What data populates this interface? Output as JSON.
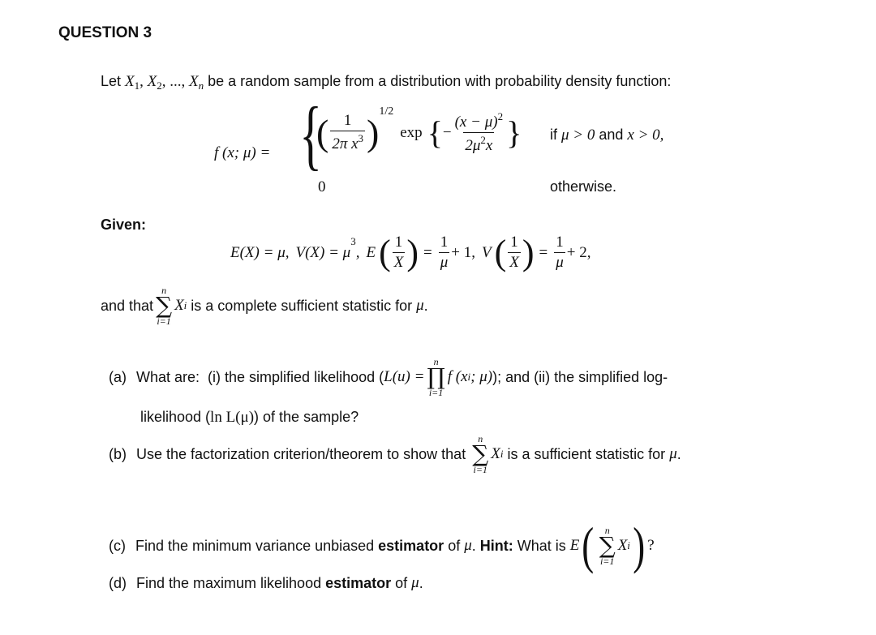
{
  "question_title": "QUESTION 3",
  "intro": {
    "prefix": "Let ",
    "x1": "X",
    "x1_sub": "1",
    "x2": "X",
    "x2_sub": "2",
    "dots": ", ..., ",
    "xn": "X",
    "xn_sub": "n",
    "suffix": " be a random sample from a distribution with probability density function:"
  },
  "pdf": {
    "lhs": "f (x; μ) =",
    "case1": {
      "frac_num": "1",
      "frac_den": "2π x",
      "frac_den_sup": "3",
      "power": "1/2",
      "exp_label": "exp",
      "minus": "−",
      "exp_num": "(x − μ)",
      "exp_num_sup": "2",
      "exp_den": "2μ",
      "exp_den_sup": "2",
      "exp_den_tail": "x",
      "condition_if": "if ",
      "condition_mu": "μ > 0",
      "condition_and": " and ",
      "condition_x": "x > 0,"
    },
    "case2": {
      "value": "0",
      "condition": "otherwise."
    }
  },
  "given": {
    "label": "Given:",
    "ex": "E(X) = μ,",
    "vx": "V(X) = μ",
    "vx_sup": "3",
    "vx_comma": ",",
    "e_inv": "E",
    "inv_num": "1",
    "inv_den": "X",
    "eq": "=",
    "mu_num": "1",
    "mu_den": "μ",
    "plus1": "+ 1,",
    "v_inv": "V",
    "plus2": "+ 2,"
  },
  "sufficient": {
    "prefix": "and that ",
    "sum_top": "n",
    "sum_bottom": "i=1",
    "sum_symbol": "∑",
    "term": "X",
    "term_sub": "i",
    "suffix": " is a complete sufficient statistic for ",
    "mu": "μ",
    "end": "."
  },
  "parts": {
    "a": {
      "label": "(a)",
      "text1": "What are:  (i) the simplified likelihood (",
      "L": "L(u) =",
      "prod_top": "n",
      "prod_bottom": "i=1",
      "prod_symbol": "∏",
      "f_term": "f (x",
      "f_sub": "i",
      "f_tail": "; μ)",
      "text2": "); and (ii) the simplified log-",
      "line2_a": "likelihood (",
      "lnL": "ln L(μ)",
      "line2_b": ") of the sample?"
    },
    "b": {
      "label": "(b)",
      "text1": "Use the factorization criterion/theorem to show that ",
      "sum_top": "n",
      "sum_bottom": "i=1",
      "sum_symbol": "∑",
      "term": "X",
      "term_sub": "i",
      "text2": " is a sufficient statistic for ",
      "mu": "μ",
      "end": "."
    },
    "c": {
      "label": "(c)",
      "text1": "Find the minimum variance unbiased ",
      "bold1": "estimator",
      "text2": " of ",
      "mu": "μ",
      "text3": ". ",
      "hint_label": "Hint:",
      "text4": " What is ",
      "E": "E",
      "sum_top": "n",
      "sum_bottom": "i=1",
      "sum_symbol": "∑",
      "term": "X",
      "term_sub": "i",
      "end": "?"
    },
    "d": {
      "label": "(d)",
      "text1": "Find the maximum likelihood ",
      "bold1": "estimator",
      "text2": " of ",
      "mu": "μ",
      "end": "."
    }
  }
}
